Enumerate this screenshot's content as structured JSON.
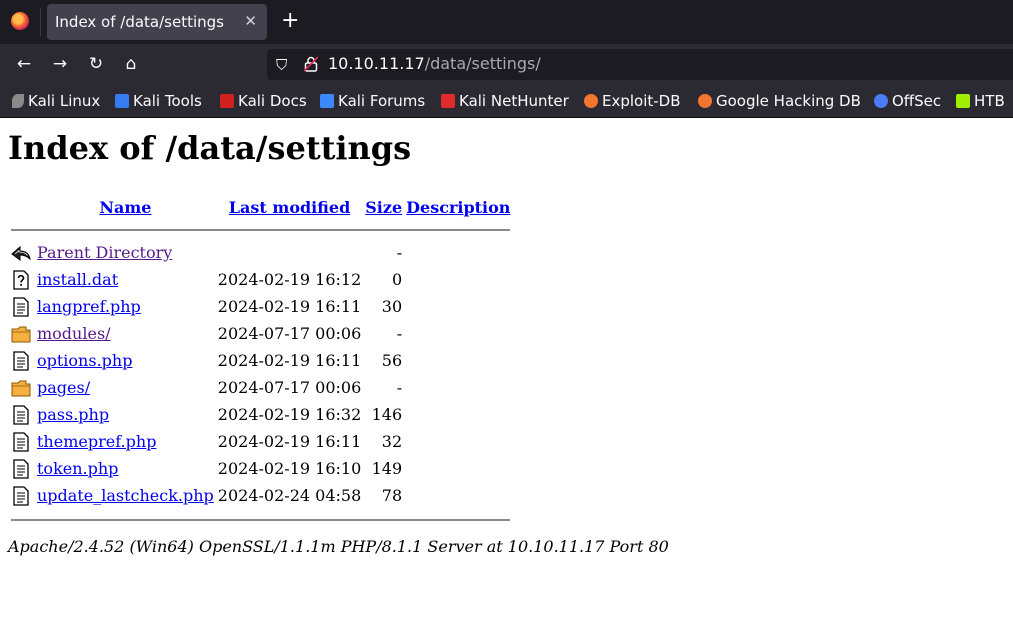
{
  "browser": {
    "tab_title": "Index of /data/settings",
    "tab_close": "✕",
    "new_tab": "+",
    "url_host": "10.10.11.17",
    "url_path": "/data/settings/",
    "nav": {
      "back": "←",
      "forward": "→",
      "reload": "↻",
      "home": "⌂"
    },
    "shield": "⛉"
  },
  "bookmarks": [
    {
      "label": "Kali Linux",
      "color": "#367bf0"
    },
    {
      "label": "Kali Tools",
      "color": "#e2412b"
    },
    {
      "label": "Kali Docs",
      "color": "#d0211c"
    },
    {
      "label": "Kali Forums",
      "color": "#3b88ff"
    },
    {
      "label": "Kali NetHunter",
      "color": "#e02c2c"
    },
    {
      "label": "Exploit-DB",
      "color": "#f2762e"
    },
    {
      "label": "Google Hacking DB",
      "color": "#f2762e"
    },
    {
      "label": "OffSec",
      "color": "#4c7cf3"
    },
    {
      "label": "HTB",
      "color": "#9fef00"
    }
  ],
  "page": {
    "heading": "Index of /data/settings",
    "columns": {
      "name": "Name",
      "modified": "Last modified",
      "size": "Size",
      "description": "Description"
    },
    "rows": [
      {
        "icon": "back-icon",
        "name": "Parent Directory",
        "modified": "",
        "size": "-",
        "visited": true
      },
      {
        "icon": "unknown-file-icon",
        "name": "install.dat",
        "modified": "2024-02-19 16:12",
        "size": "0",
        "visited": false
      },
      {
        "icon": "text-file-icon",
        "name": "langpref.php",
        "modified": "2024-02-19 16:11",
        "size": "30",
        "visited": false
      },
      {
        "icon": "folder-icon",
        "name": "modules/",
        "modified": "2024-07-17 00:06",
        "size": "-",
        "visited": true
      },
      {
        "icon": "text-file-icon",
        "name": "options.php",
        "modified": "2024-02-19 16:11",
        "size": "56",
        "visited": false
      },
      {
        "icon": "folder-icon",
        "name": "pages/",
        "modified": "2024-07-17 00:06",
        "size": "-",
        "visited": false
      },
      {
        "icon": "text-file-icon",
        "name": "pass.php",
        "modified": "2024-02-19 16:32",
        "size": "146",
        "visited": false
      },
      {
        "icon": "text-file-icon",
        "name": "themepref.php",
        "modified": "2024-02-19 16:11",
        "size": "32",
        "visited": false
      },
      {
        "icon": "text-file-icon",
        "name": "token.php",
        "modified": "2024-02-19 16:10",
        "size": "149",
        "visited": false
      },
      {
        "icon": "text-file-icon",
        "name": "update_lastcheck.php",
        "modified": "2024-02-24 04:58",
        "size": "78",
        "visited": false
      }
    ],
    "footer": "Apache/2.4.52 (Win64) OpenSSL/1.1.1m PHP/8.1.1 Server at 10.10.11.17 Port 80"
  }
}
